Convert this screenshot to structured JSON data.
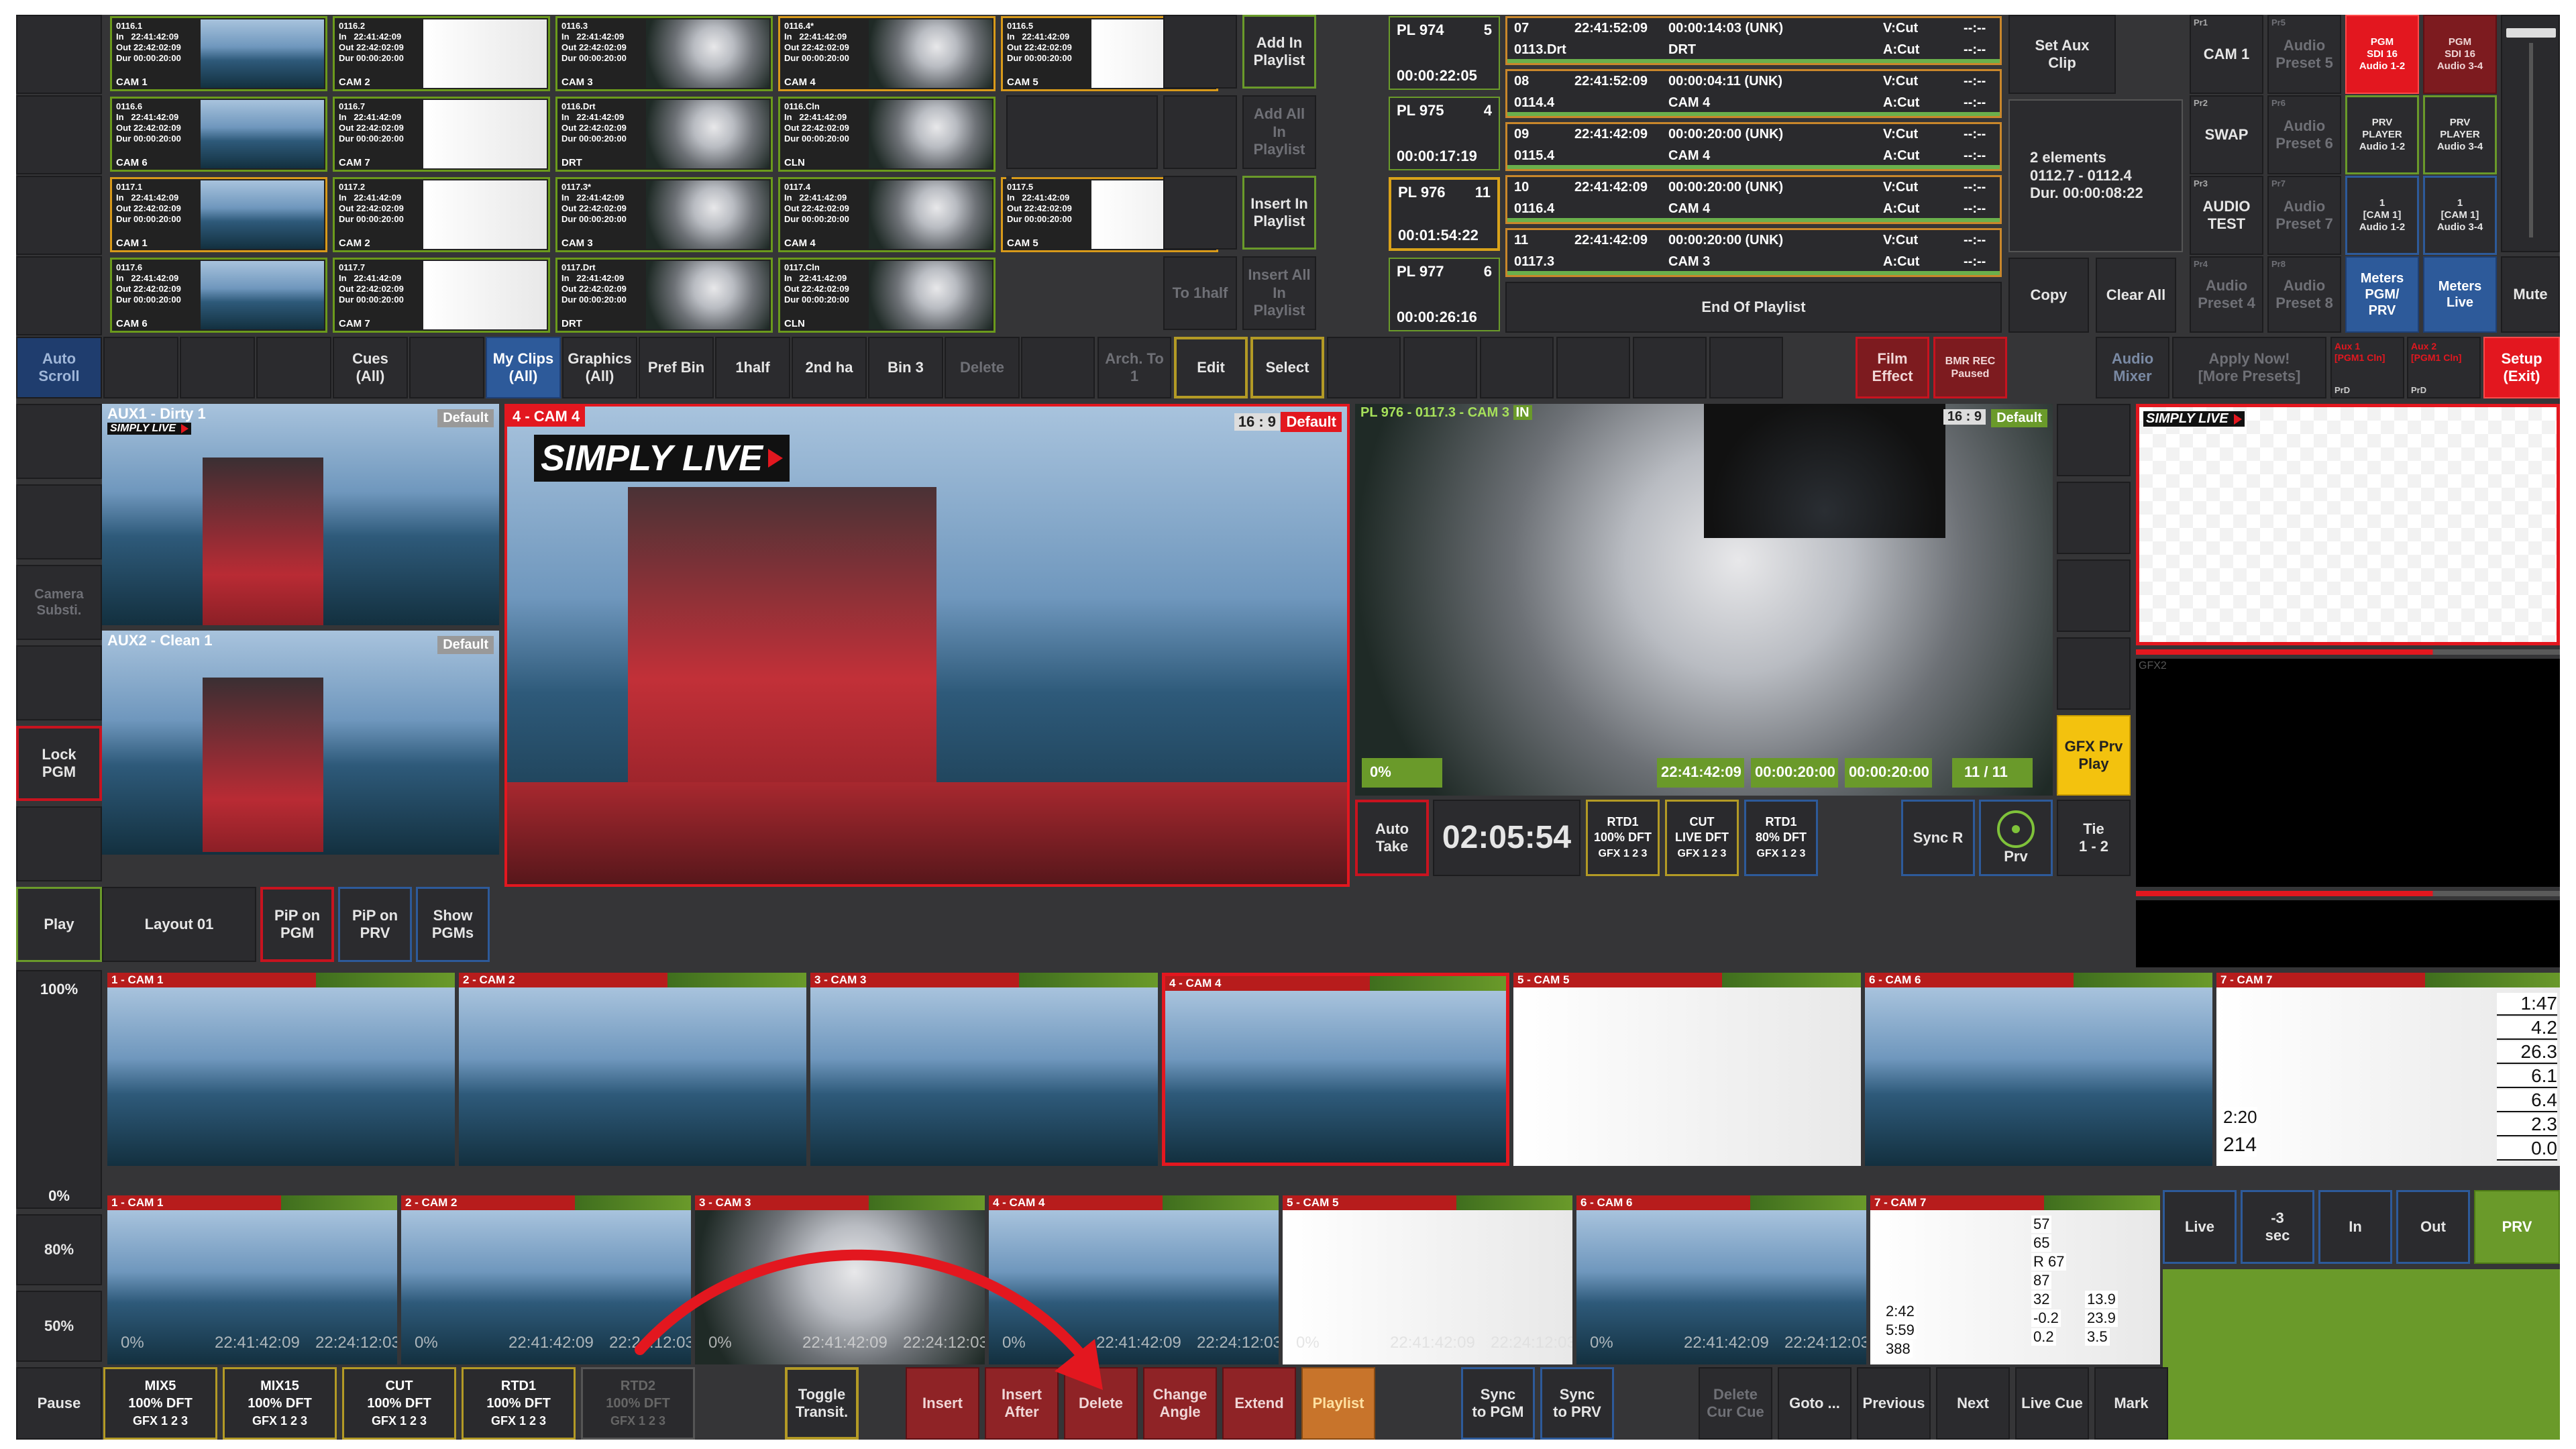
{
  "clips": [
    {
      "id": "0116.1",
      "in": "22:41:42:09",
      "out": "22:42:02:09",
      "dur": "00:00:20:00",
      "cam": "CAM 1"
    },
    {
      "id": "0116.2",
      "in": "22:41:42:09",
      "out": "22:42:02:09",
      "dur": "00:00:20:00",
      "cam": "CAM 2"
    },
    {
      "id": "0116.3",
      "in": "22:41:42:09",
      "out": "22:42:02:09",
      "dur": "00:00:20:00",
      "cam": "CAM 3"
    },
    {
      "id": "0116.4*",
      "in": "22:41:42:09",
      "out": "22:42:02:09",
      "dur": "00:00:20:00",
      "cam": "CAM 4"
    },
    {
      "id": "0116.5",
      "in": "22:41:42:09",
      "out": "22:42:02:09",
      "dur": "00:00:20:00",
      "cam": "CAM 5"
    },
    {
      "id": "0116.6",
      "in": "22:41:42:09",
      "out": "22:42:02:09",
      "dur": "00:00:20:00",
      "cam": "CAM 6"
    },
    {
      "id": "0116.7",
      "in": "22:41:42:09",
      "out": "22:42:02:09",
      "dur": "00:00:20:00",
      "cam": "CAM 7"
    },
    {
      "id": "0116.Drt",
      "in": "22:41:42:09",
      "out": "22:42:02:09",
      "dur": "00:00:20:00",
      "cam": "DRT"
    },
    {
      "id": "0116.Cln",
      "in": "22:41:42:09",
      "out": "22:42:02:09",
      "dur": "00:00:20:00",
      "cam": "CLN"
    },
    {
      "id": "0117.1",
      "in": "22:41:42:09",
      "out": "22:42:02:09",
      "dur": "00:00:20:00",
      "cam": "CAM 1"
    },
    {
      "id": "0117.2",
      "in": "22:41:42:09",
      "out": "22:42:02:09",
      "dur": "00:00:20:00",
      "cam": "CAM 2"
    },
    {
      "id": "0117.3*",
      "in": "22:41:42:09",
      "out": "22:42:02:09",
      "dur": "00:00:20:00",
      "cam": "CAM 3"
    },
    {
      "id": "0117.4",
      "in": "22:41:42:09",
      "out": "22:42:02:09",
      "dur": "00:00:20:00",
      "cam": "CAM 4"
    },
    {
      "id": "0117.5",
      "in": "22:41:42:09",
      "out": "22:42:02:09",
      "dur": "00:00:20:00",
      "cam": "CAM 5"
    },
    {
      "id": "0117.6",
      "in": "22:41:42:09",
      "out": "22:42:02:09",
      "dur": "00:00:20:00",
      "cam": "CAM 6"
    },
    {
      "id": "0117.7",
      "in": "22:41:42:09",
      "out": "22:42:02:09",
      "dur": "00:00:20:00",
      "cam": "CAM 7"
    },
    {
      "id": "0117.Drt",
      "in": "22:41:42:09",
      "out": "22:42:02:09",
      "dur": "00:00:20:00",
      "cam": "DRT"
    },
    {
      "id": "0117.Cln",
      "in": "22:41:42:09",
      "out": "22:42:02:09",
      "dur": "00:00:20:00",
      "cam": "CLN"
    }
  ],
  "clip_prefix": {
    "in": "In",
    "out": "Out",
    "dur": "Dur"
  },
  "playlist_actions": {
    "add_in": "Add In\nPlaylist",
    "add_all": "Add All\nIn\nPlaylist",
    "insert_in": "Insert In\nPlaylist",
    "insert_all": "Insert All\nIn\nPlaylist",
    "to_1half": "To 1half"
  },
  "playlists": [
    {
      "name": "PL 974",
      "count": "5",
      "dur": "00:00:22:05"
    },
    {
      "name": "PL 975",
      "count": "4",
      "dur": "00:00:17:19"
    },
    {
      "name": "PL 976",
      "count": "11",
      "dur": "00:01:54:22"
    },
    {
      "name": "PL 977",
      "count": "6",
      "dur": "00:00:26:16"
    }
  ],
  "playlist_items": [
    {
      "num": "07",
      "tc": "22:41:52:09",
      "dur": "00:00:14:03 (UNK)",
      "v": "V:Cut",
      "a": "A:Cut",
      "clip": "0113.Drt",
      "cam": "DRT",
      "x1": "--:--",
      "x2": "--:--"
    },
    {
      "num": "08",
      "tc": "22:41:52:09",
      "dur": "00:00:04:11 (UNK)",
      "v": "V:Cut",
      "a": "A:Cut",
      "clip": "0114.4",
      "cam": "CAM 4",
      "x1": "--:--",
      "x2": "--:--"
    },
    {
      "num": "09",
      "tc": "22:41:42:09",
      "dur": "00:00:20:00 (UNK)",
      "v": "V:Cut",
      "a": "A:Cut",
      "clip": "0115.4",
      "cam": "CAM 4",
      "x1": "--:--",
      "x2": "--:--"
    },
    {
      "num": "10",
      "tc": "22:41:42:09",
      "dur": "00:00:20:00 (UNK)",
      "v": "V:Cut",
      "a": "A:Cut",
      "clip": "0116.4",
      "cam": "CAM 4",
      "x1": "--:--",
      "x2": "--:--"
    },
    {
      "num": "11",
      "tc": "22:41:42:09",
      "dur": "00:00:20:00 (UNK)",
      "v": "V:Cut",
      "a": "A:Cut",
      "clip": "0117.3",
      "cam": "CAM 3",
      "x1": "--:--",
      "x2": "--:--"
    }
  ],
  "end_of_playlist": "End Of Playlist",
  "aux": {
    "set_aux": "Set Aux\nClip",
    "elements": "2 elements\n0112.7 - 0112.4\nDur. 00:00:08:22",
    "copy": "Copy",
    "clear_all": "Clear All"
  },
  "right_grid": {
    "cam1": "CAM 1",
    "pr1": "Pr1",
    "swap": "SWAP",
    "pr2": "Pr2",
    "audio_test": "AUDIO\nTEST",
    "pr3": "Pr3",
    "ap5": "Audio\nPreset 5",
    "pr5": "Pr5",
    "ap6": "Audio\nPreset 6",
    "pr6": "Pr6",
    "ap7": "Audio\nPreset 7",
    "pr7": "Pr7",
    "ap4": "Audio\nPreset 4",
    "pr4": "Pr4",
    "ap8": "Audio\nPreset 8",
    "pr8": "Pr8",
    "pgm1": "PGM\nSDI 16\nAudio 1-2",
    "pgm2": "PGM\nSDI 16\nAudio 3-4",
    "prv1": "PRV\nPLAYER\nAudio 1-2",
    "prv2": "PRV\nPLAYER\nAudio 3-4",
    "cam1a": "1\n[CAM 1]\nAudio 1-2",
    "cam1b": "1\n[CAM 1]\nAudio 3-4",
    "meters_pgm": "Meters\nPGM/\nPRV",
    "meters_live": "Meters\nLive",
    "mute": "Mute"
  },
  "toolbar": {
    "auto_scroll": "Auto\nScroll",
    "cues": "Cues\n(All)",
    "my_clips": "My Clips\n(All)",
    "graphics": "Graphics\n(All)",
    "pref_bin": "Pref Bin",
    "half1": "1half",
    "half2": "2nd ha",
    "bin3": "Bin 3",
    "delete": "Delete",
    "arch": "Arch. To\n1",
    "edit": "Edit",
    "select": "Select",
    "film": "Film\nEffect",
    "bmr": "BMR REC\nPaused",
    "audio_mixer": "Audio\nMixer",
    "apply_now": "Apply Now!\n[More Presets]",
    "aux1": "Aux 1\n[PGM1 Cln]",
    "aux1_sub": "PrD",
    "aux2": "Aux 2\n[PGM1 Cln]",
    "aux2_sub": "PrD",
    "setup": "Setup\n(Exit)"
  },
  "left_col": {
    "camera_subst": "Camera\nSubsti.",
    "lock_pgm": "Lock\nPGM",
    "play": "Play",
    "pct100": "100%",
    "pct0": "0%",
    "pct80": "80%",
    "pct50": "50%",
    "pause": "Pause"
  },
  "monitors": {
    "aux1": "AUX1 - Dirty 1",
    "aux2": "AUX2 - Clean 1",
    "default": "Default",
    "cam4": "4 - CAM 4",
    "ratio": "16 : 9",
    "brand": "SIMPLY LIVE",
    "pl_title": "PL 976 - 0117.3 - CAM 3",
    "in": "IN",
    "pct": "0%",
    "tc1": "22:41:42:09",
    "tc2": "00:00:20:00",
    "tc3": "00:00:20:00",
    "pos": "11 / 11",
    "gfx2": "GFX2",
    "gfx_prv_play": "GFX Prv\nPlay"
  },
  "controls": {
    "auto_take": "Auto\nTake",
    "clock": "02:05:54",
    "rtd1": "RTD1\n100% DFT",
    "cut": "CUT\nLIVE DFT",
    "rtd1b": "RTD1\n80% DFT",
    "gfx": "GFX 1 2 3",
    "sync_r": "Sync R",
    "prv": "Prv",
    "tie": "Tie\n1 - 2"
  },
  "layout": {
    "layout01": "Layout 01",
    "pip_pgm": "PiP on\nPGM",
    "pip_prv": "PiP on\nPRV",
    "show_pgms": "Show\nPGMs"
  },
  "cams_top": [
    "1 - CAM 1",
    "2 - CAM 2",
    "3 - CAM 3",
    "4 - CAM 4",
    "5 - CAM 5",
    "6 - CAM 6",
    "7 - CAM 7"
  ],
  "cams_bot": [
    "1 - CAM 1",
    "2 - CAM 2",
    "3 - CAM 3",
    "4 - CAM 4",
    "5 - CAM 5",
    "6 - CAM 6",
    "7 - CAM 7"
  ],
  "bot_overlay": {
    "pct": "0%",
    "tc1": "22:41:42:09",
    "tc2": "22:24:12:03"
  },
  "cam7_readout": {
    "v1": "1:47",
    "v2": "4.2",
    "v3": "26.3",
    "v4": "6.1",
    "v5": "6.4",
    "v6": "2.3",
    "v7": "0.0",
    "time": "2:20",
    "num": "214"
  },
  "cam7b_readout": {
    "v1": "57",
    "v2": "65",
    "v3": "R 67",
    "v4": "87",
    "v5": "32",
    "v6": "13.9",
    "v7": "-0.2",
    "v8": "23.9",
    "v9": "0.2",
    "v10": "3.5",
    "t1": "2:42",
    "t2": "5:59",
    "t3": "388"
  },
  "bottom": {
    "mix5": "MIX5\n100% DFT",
    "mix15": "MIX15\n100% DFT",
    "cut": "CUT\n100% DFT",
    "rtd1": "RTD1\n100% DFT",
    "rtd2": "RTD2\n100% DFT",
    "gfx": "GFX 1 2 3",
    "toggle": "Toggle\nTransit.",
    "insert": "Insert",
    "insert_after": "Insert\nAfter",
    "delete": "Delete",
    "change_angle": "Change\nAngle",
    "extend": "Extend",
    "playlist": "Playlist",
    "sync_pgm": "Sync\nto PGM",
    "sync_prv": "Sync\nto PRV",
    "delete_cue": "Delete\nCur Cue",
    "goto": "Goto ...",
    "previous": "Previous",
    "next": "Next",
    "live_cue": "Live Cue",
    "mark": "Mark"
  },
  "transport": {
    "live": "Live",
    "minus3": "-3\nsec",
    "in": "In",
    "out": "Out",
    "prv": "PRV"
  },
  "colors": {
    "accent_red": "#e3171f",
    "accent_green": "#6a9a2a",
    "accent_blue": "#2d5a9a",
    "accent_yellow": "#f3c20e",
    "panel": "#353537"
  }
}
